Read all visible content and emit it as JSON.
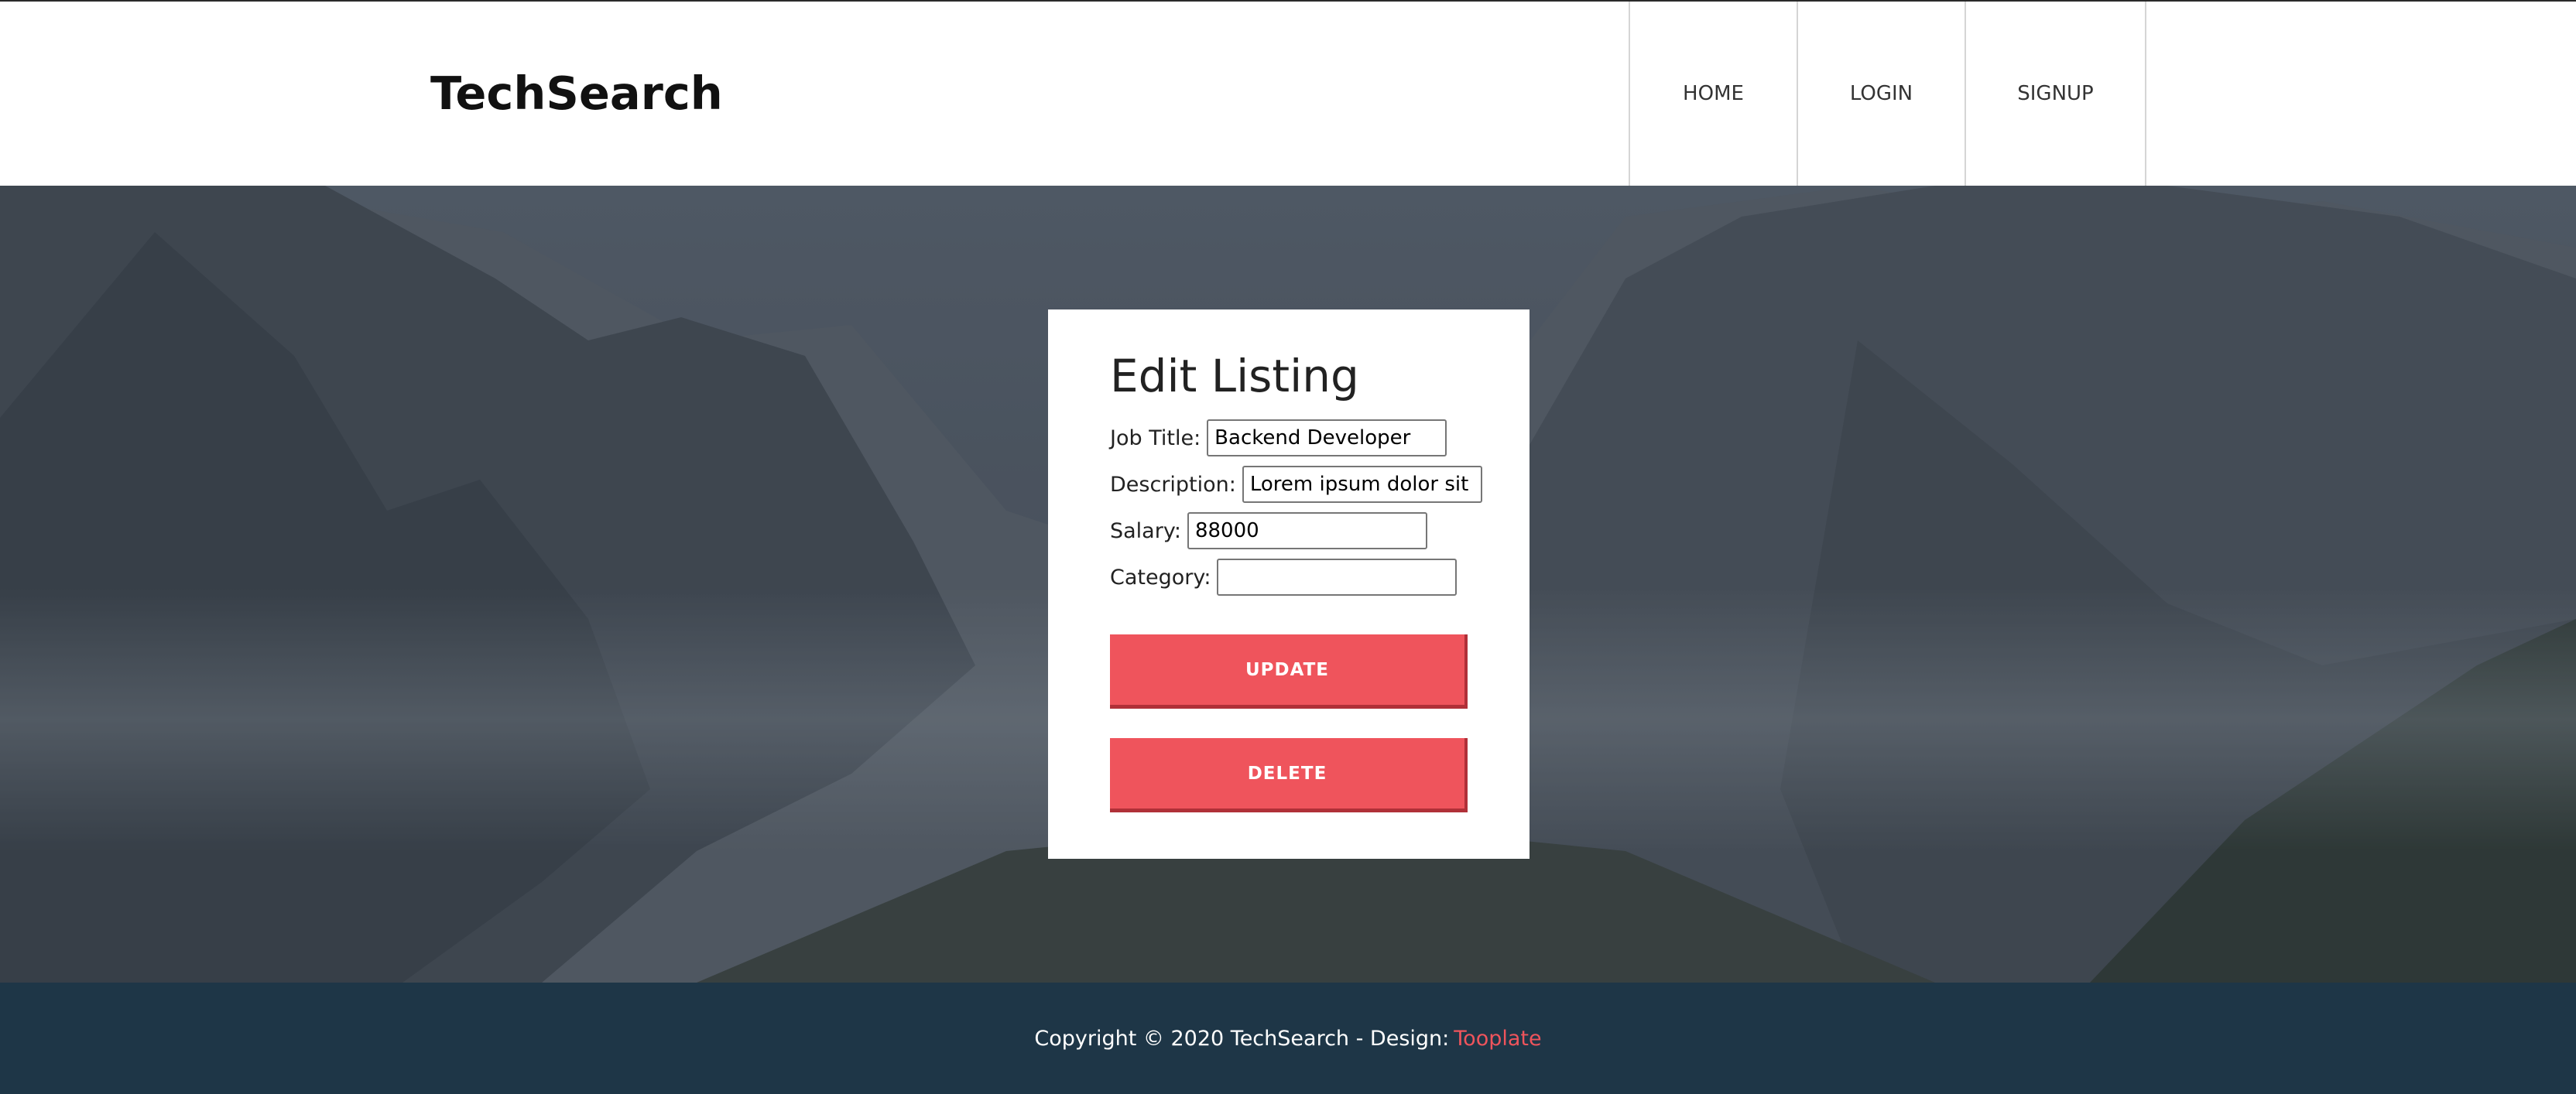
{
  "header": {
    "brand": "TechSearch",
    "nav": [
      {
        "label": "HOME"
      },
      {
        "label": "LOGIN"
      },
      {
        "label": "SIGNUP"
      }
    ]
  },
  "form": {
    "title": "Edit Listing",
    "fields": {
      "job_title": {
        "label": "Job Title:",
        "value": "Backend Developer"
      },
      "description": {
        "label": "Description:",
        "value": "Lorem ipsum dolor sit amet"
      },
      "salary": {
        "label": "Salary:",
        "value": "88000"
      },
      "category": {
        "label": "Category:",
        "value": ""
      }
    },
    "update_label": "UPDATE",
    "delete_label": "DELETE"
  },
  "footer": {
    "copyright": "Copyright © 2020 TechSearch - Design:",
    "design_link": "Tooplate"
  },
  "colors": {
    "accent": "#ef545c",
    "footer_bg": "#1e3647",
    "header_bg": "#ffffff"
  }
}
